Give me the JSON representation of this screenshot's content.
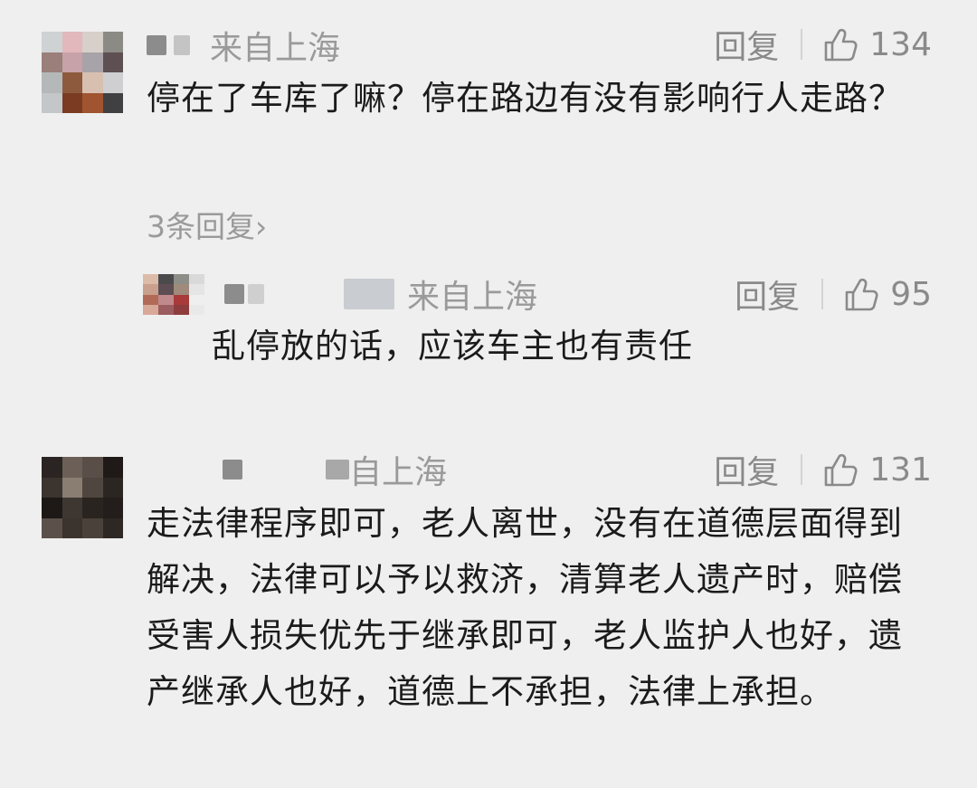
{
  "comments": [
    {
      "location": "来自上海",
      "reply_label": "回复",
      "likes": "134",
      "text": "停在了车库了嘛？停在路边有没有影响行人走路？",
      "replies_link": "3条回复›",
      "avatar_colors": [
        "#cfd2d3",
        "#e2b8bc",
        "#d7cfc9",
        "#8c8a84",
        "#9b7f7a",
        "#c7a2a8",
        "#a8a3a8",
        "#5d4f52",
        "#b5b8b9",
        "#8e5a3e",
        "#d8c0b0",
        "#cfcfd2",
        "#c4c7c9",
        "#7a3b22",
        "#a0542f",
        "#404042"
      ]
    },
    {
      "location": "来自上海",
      "reply_label": "回复",
      "likes": "95",
      "text": "乱停放的话，应该车主也有责任",
      "avatar_colors": [
        "#dcbca8",
        "#4a4a4c",
        "#8e8e88",
        "#d9d9d9",
        "#c9a08d",
        "#5e4d52",
        "#a08a7c",
        "#e5e5e5",
        "#b06a55",
        "#c08a8c",
        "#a83a3a",
        "#efefef",
        "#d8a898",
        "#9c5d60",
        "#8e3c3c",
        "#e9e9e9"
      ]
    },
    {
      "location": "自上海",
      "reply_label": "回复",
      "likes": "131",
      "text": "走法律程序即可，老人离世，没有在道德层面得到解决，法律可以予以救济，清算老人遗产时，赔偿受害人损失优先于继承即可，老人监护人也好，遗产继承人也好，道德上不承担，法律上承担。",
      "avatar_colors": [
        "#2a2522",
        "#6b5f57",
        "#5a4f48",
        "#1f1a17",
        "#3b342f",
        "#8a7d72",
        "#4f4640",
        "#2c2622",
        "#1d1916",
        "#3e3630",
        "#2a2420",
        "#231e1b",
        "#5b514a",
        "#3a332e",
        "#4a413b",
        "#2e2824"
      ]
    }
  ]
}
